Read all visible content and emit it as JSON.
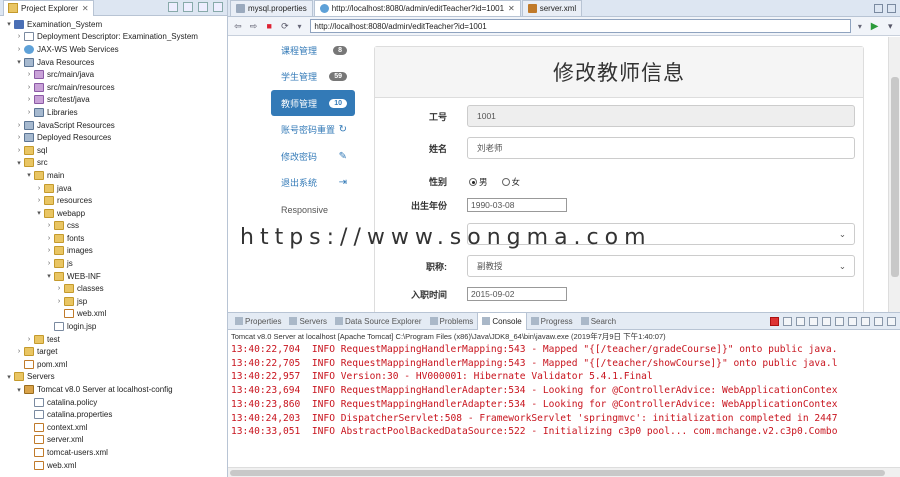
{
  "explorer": {
    "tab_label": "Project Explorer",
    "tab_close": "✕",
    "tree": [
      {
        "indent": 0,
        "tw": "▾",
        "icon": "ic-project",
        "label": "Examination_System"
      },
      {
        "indent": 1,
        "tw": "›",
        "icon": "ic-file",
        "label": "Deployment Descriptor: Examination_System"
      },
      {
        "indent": 1,
        "tw": "›",
        "icon": "ic-globe",
        "label": "JAX-WS Web Services"
      },
      {
        "indent": 1,
        "tw": "▾",
        "icon": "ic-lib",
        "label": "Java Resources"
      },
      {
        "indent": 2,
        "tw": "›",
        "icon": "ic-pkg",
        "label": "src/main/java"
      },
      {
        "indent": 2,
        "tw": "›",
        "icon": "ic-pkg",
        "label": "src/main/resources"
      },
      {
        "indent": 2,
        "tw": "›",
        "icon": "ic-pkg",
        "label": "src/test/java"
      },
      {
        "indent": 2,
        "tw": "›",
        "icon": "ic-lib",
        "label": "Libraries"
      },
      {
        "indent": 1,
        "tw": "›",
        "icon": "ic-lib",
        "label": "JavaScript Resources"
      },
      {
        "indent": 1,
        "tw": "›",
        "icon": "ic-lib",
        "label": "Deployed Resources"
      },
      {
        "indent": 1,
        "tw": "›",
        "icon": "ic-folder",
        "label": "sql"
      },
      {
        "indent": 1,
        "tw": "▾",
        "icon": "ic-folder",
        "label": "src"
      },
      {
        "indent": 2,
        "tw": "▾",
        "icon": "ic-folder",
        "label": "main"
      },
      {
        "indent": 3,
        "tw": "›",
        "icon": "ic-folder",
        "label": "java"
      },
      {
        "indent": 3,
        "tw": "›",
        "icon": "ic-folder",
        "label": "resources"
      },
      {
        "indent": 3,
        "tw": "▾",
        "icon": "ic-folder",
        "label": "webapp"
      },
      {
        "indent": 4,
        "tw": "›",
        "icon": "ic-folder",
        "label": "css"
      },
      {
        "indent": 4,
        "tw": "›",
        "icon": "ic-folder",
        "label": "fonts"
      },
      {
        "indent": 4,
        "tw": "›",
        "icon": "ic-folder",
        "label": "images"
      },
      {
        "indent": 4,
        "tw": "›",
        "icon": "ic-folder",
        "label": "js"
      },
      {
        "indent": 4,
        "tw": "▾",
        "icon": "ic-folder",
        "label": "WEB-INF"
      },
      {
        "indent": 5,
        "tw": "›",
        "icon": "ic-folder",
        "label": "classes"
      },
      {
        "indent": 5,
        "tw": "›",
        "icon": "ic-folder",
        "label": "jsp"
      },
      {
        "indent": 5,
        "tw": "",
        "icon": "ic-xml",
        "label": "web.xml"
      },
      {
        "indent": 4,
        "tw": "",
        "icon": "ic-file",
        "label": "login.jsp"
      },
      {
        "indent": 2,
        "tw": "›",
        "icon": "ic-folder",
        "label": "test"
      },
      {
        "indent": 1,
        "tw": "›",
        "icon": "ic-folder",
        "label": "target"
      },
      {
        "indent": 1,
        "tw": "",
        "icon": "ic-xml",
        "label": "pom.xml"
      },
      {
        "indent": 0,
        "tw": "▾",
        "icon": "ic-folder",
        "label": "Servers"
      },
      {
        "indent": 1,
        "tw": "▾",
        "icon": "ic-tomcat",
        "label": "Tomcat v8.0 Server at localhost-config"
      },
      {
        "indent": 2,
        "tw": "",
        "icon": "ic-file",
        "label": "catalina.policy"
      },
      {
        "indent": 2,
        "tw": "",
        "icon": "ic-file",
        "label": "catalina.properties"
      },
      {
        "indent": 2,
        "tw": "",
        "icon": "ic-xml",
        "label": "context.xml"
      },
      {
        "indent": 2,
        "tw": "",
        "icon": "ic-xml",
        "label": "server.xml"
      },
      {
        "indent": 2,
        "tw": "",
        "icon": "ic-xml",
        "label": "tomcat-users.xml"
      },
      {
        "indent": 2,
        "tw": "",
        "icon": "ic-xml",
        "label": "web.xml"
      }
    ]
  },
  "editor": {
    "tabs": [
      {
        "label": "mysql.properties",
        "active": false
      },
      {
        "label": "http://localhost:8080/admin/editTeacher?id=1001",
        "active": true
      },
      {
        "label": "server.xml",
        "active": false
      }
    ],
    "url": "http://localhost:8080/admin/editTeacher?id=1001"
  },
  "sidenav": {
    "items": [
      {
        "label": "课程管理",
        "badge": "8",
        "active": false
      },
      {
        "label": "学生管理",
        "badge": "59",
        "active": false
      },
      {
        "label": "教师管理",
        "badge": "10",
        "active": true
      }
    ],
    "reset_label": "账号密码重置",
    "change_pwd_label": "修改密码",
    "logout_label": "退出系统",
    "responsive_label": "Responsive"
  },
  "form": {
    "title": "修改教师信息",
    "id_label": "工号",
    "id_value": "1001",
    "name_label": "姓名",
    "name_value": "刘老师",
    "gender_label": "性别",
    "gender_male": "男",
    "gender_female": "女",
    "birth_label": "出生年份",
    "birth_value": "1990-03-08",
    "title_label": "职称:",
    "title_value": "副教授",
    "entry_label": "入职时间",
    "entry_value": "2015-09-02"
  },
  "watermark": "https://www.songma.com",
  "console": {
    "tabs": [
      "Properties",
      "Servers",
      "Data Source Explorer",
      "Problems",
      "Console",
      "Progress",
      "Search"
    ],
    "active_tab": "Console",
    "title": "Tomcat v8.0 Server at localhost [Apache Tomcat] C:\\Program Files (x86)\\Java\\JDK8_64\\bin\\javaw.exe (2019年7月9日 下午1:40:07)",
    "lines": [
      "13:40:22,704  INFO RequestMappingHandlerMapping:543 - Mapped \"{[/teacher/gradeCourse]}\" onto public java.",
      "13:40:22,705  INFO RequestMappingHandlerMapping:543 - Mapped \"{[/teacher/showCourse]}\" onto public java.l",
      "13:40:22,957  INFO Version:30 - HV000001: Hibernate Validator 5.4.1.Final",
      "13:40:23,694  INFO RequestMappingHandlerAdapter:534 - Looking for @ControllerAdvice: WebApplicationContex",
      "13:40:23,860  INFO RequestMappingHandlerAdapter:534 - Looking for @ControllerAdvice: WebApplicationContex",
      "13:40:24,203  INFO DispatcherServlet:508 - FrameworkServlet 'springmvc': initialization completed in 2447",
      "13:40:33,051  INFO AbstractPoolBackedDataSource:522 - Initializing c3p0 pool... com.mchange.v2.c3p0.Combo"
    ]
  }
}
